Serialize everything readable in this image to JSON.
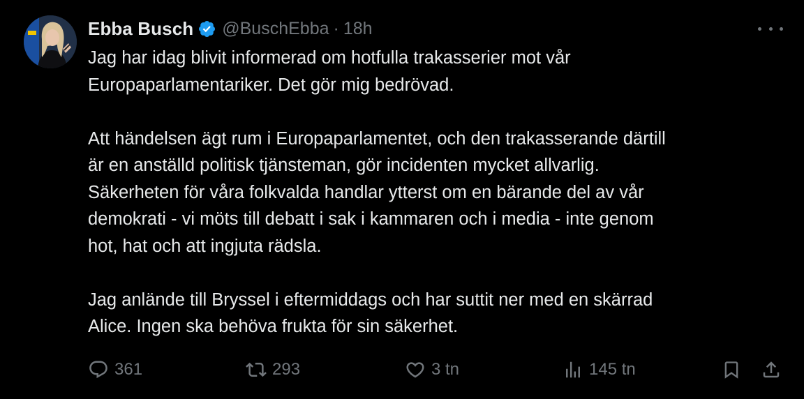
{
  "author": {
    "display_name": "Ebba Busch",
    "handle": "@BuschEbba",
    "separator": "·",
    "time": "18h",
    "verified_color": "#1d9bf0"
  },
  "tweet": {
    "paragraphs": [
      [
        "Jag har idag blivit informerad om hotfulla trakasserier mot vår",
        "Europaparlamentariker. Det gör mig bedrövad."
      ],
      [
        "Att händelsen ägt rum i Europaparlamentet, och den trakasserande därtill",
        "är en anställd politisk tjänsteman, gör incidenten mycket allvarlig.",
        "Säkerheten för våra folkvalda handlar ytterst om en bärande del av vår",
        "demokrati - vi möts till debatt i sak i kammaren och i media - inte genom",
        "hot, hat och att ingjuta rädsla."
      ],
      [
        "Jag anlände till Bryssel i eftermiddags och har suttit ner med en skärrad",
        "Alice. Ingen ska behöva frukta för sin säkerhet."
      ]
    ]
  },
  "actions": {
    "replies": "361",
    "retweets": "293",
    "likes": "3 tn",
    "views": "145 tn"
  },
  "icons": {
    "reply": "reply-icon",
    "retweet": "retweet-icon",
    "like": "heart-icon",
    "views": "views-icon",
    "bookmark": "bookmark-icon",
    "share": "share-icon",
    "more": "more-icon",
    "verified": "verified-badge-icon"
  },
  "colors": {
    "background": "#000000",
    "text": "#e7e9ea",
    "secondary": "#71767b"
  }
}
